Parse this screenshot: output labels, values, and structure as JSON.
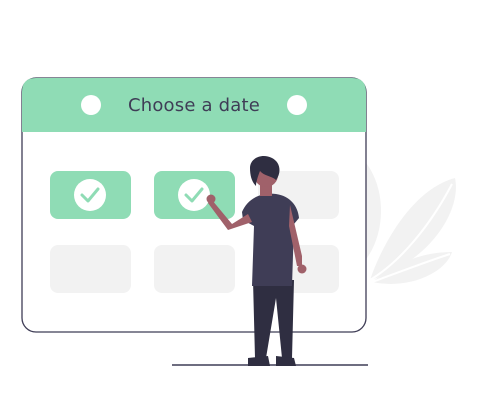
{
  "calendar": {
    "title": "Choose a date"
  },
  "colors": {
    "accent": "#8fdcb5",
    "accent_light": "#9be0be",
    "slot_empty": "#f2f2f2",
    "leaf": "#f2f2f2",
    "border": "#3f3d56",
    "skin": "#a0616a",
    "hair": "#2f2e41",
    "shirt": "#3f3d56",
    "ground": "#3f3d56"
  },
  "icons": {
    "header_dots": "circle-icon",
    "slot_marks": "check-icon",
    "background": "leaf-icon"
  }
}
